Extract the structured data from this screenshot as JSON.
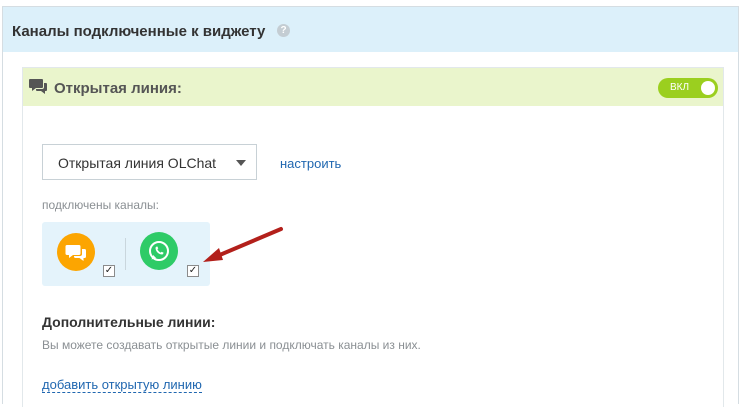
{
  "header": {
    "title": "Каналы подключенные к виджету",
    "help_icon": "?"
  },
  "panel": {
    "icon": "chat-bubbles-icon",
    "title": "Открытая линия:",
    "toggle_label": "ВКЛ",
    "toggle_on": true
  },
  "line_select": {
    "value": "Открытая линия OLChat",
    "configure_link": "настроить"
  },
  "channels": {
    "label": "подключены каналы:",
    "items": [
      {
        "name": "open-line-chat",
        "icon": "chat-bubbles-icon",
        "color": "#fca501",
        "checked": true
      },
      {
        "name": "whatsapp",
        "icon": "whatsapp-icon",
        "color": "#2ecb67",
        "checked": true
      }
    ],
    "check_mark": "✓"
  },
  "annotation": {
    "arrow_color": "#b3201b"
  },
  "extra_lines": {
    "title": "Дополнительные линии:",
    "description": "Вы можете создавать открытые линии и подключать каналы из них.",
    "add_link": "добавить открытую линию"
  }
}
